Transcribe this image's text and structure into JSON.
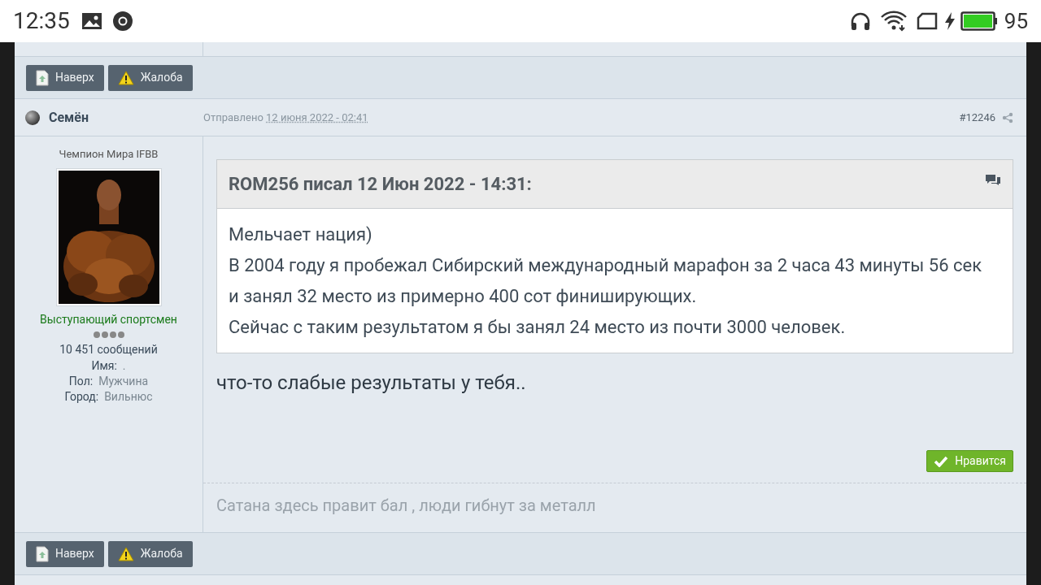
{
  "status_bar": {
    "time": "12:35",
    "battery": "95"
  },
  "top_buttons": [
    {
      "kind": "top",
      "label": "Наверх"
    },
    {
      "kind": "report",
      "label": "Жалоба"
    }
  ],
  "post": {
    "author": "Семён",
    "posted_label": "Отправлено",
    "date": "12 июня 2022 - 02:41",
    "number": "#12246",
    "rank": "Чемпион Мира IFBB",
    "group": "Выступающий спортсмен",
    "posts": "10 451 сообщений",
    "fields": [
      {
        "label": "Имя:",
        "value": "."
      },
      {
        "label": "Пол:",
        "value": "Мужчина"
      },
      {
        "label": "Город:",
        "value": "Вильнюс"
      }
    ],
    "quote": {
      "header": "ROM256 писал 12 Июн 2022 - 14:31:",
      "lines": [
        "Мельчает нация)",
        "В 2004 году я пробежал Сибирский международный марафон за 2 часа 43 минуты 56 сек",
        "и занял 32 место из примерно 400 сот финиширующих.",
        "Сейчас с таким результатом я бы занял 24 место из почти 3000 человек."
      ]
    },
    "text": "что-то слабые результаты у тебя..",
    "like": "Нравится",
    "signature": "Сатана здесь правит бал , люди гибнут за металл"
  },
  "bottom_buttons": [
    {
      "kind": "top",
      "label": "Наверх"
    },
    {
      "kind": "report",
      "label": "Жалоба"
    }
  ]
}
